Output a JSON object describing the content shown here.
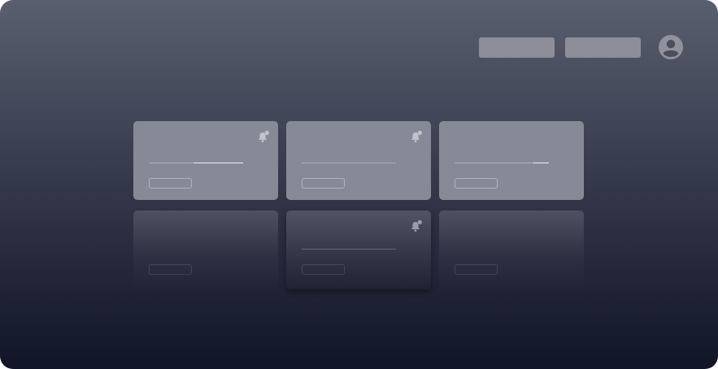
{
  "header": {
    "buttons": [
      {
        "icon": "placeholder-bar"
      },
      {
        "icon": "placeholder-bar"
      }
    ],
    "avatar_icon": "user-circle-icon"
  },
  "cards": [
    {
      "has_bell": true
    },
    {
      "has_bell": true
    },
    {
      "has_bell": false
    },
    {
      "has_bell": false
    },
    {
      "has_bell": true
    },
    {
      "has_bell": false
    }
  ],
  "colors": {
    "card": "#868a96",
    "button": "#8c8f9a",
    "background_top": "#5a5f6f",
    "background_bottom": "#111528"
  }
}
